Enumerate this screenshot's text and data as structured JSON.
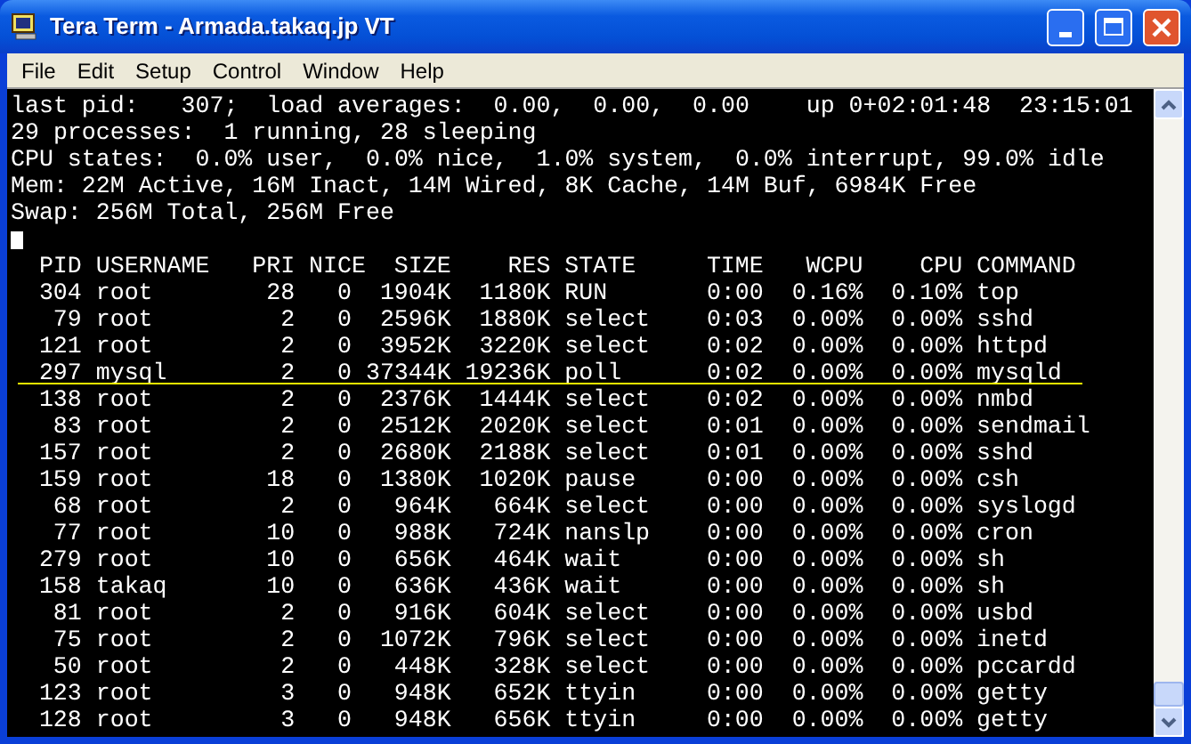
{
  "window": {
    "title": "Tera Term - Armada.takaq.jp VT"
  },
  "menu": [
    "File",
    "Edit",
    "Setup",
    "Control",
    "Window",
    "Help"
  ],
  "terminal": {
    "lines": [
      "last pid:   307;  load averages:  0.00,  0.00,  0.00    up 0+02:01:48  23:15:01",
      "29 processes:  1 running, 28 sleeping",
      "CPU states:  0.0% user,  0.0% nice,  1.0% system,  0.0% interrupt, 99.0% idle",
      "Mem: 22M Active, 16M Inact, 14M Wired, 8K Cache, 14M Buf, 6984K Free",
      "Swap: 256M Total, 256M Free"
    ],
    "cursor": true,
    "table": {
      "columns": [
        "PID",
        "USERNAME",
        "PRI",
        "NICE",
        "SIZE",
        "RES",
        "STATE",
        "TIME",
        "WCPU",
        "CPU",
        "COMMAND"
      ],
      "rows": [
        {
          "cells": [
            "304",
            "root",
            "28",
            "0",
            "1904K",
            "1180K",
            "RUN",
            "0:00",
            "0.16%",
            "0.10%",
            "top"
          ],
          "underlined": false
        },
        {
          "cells": [
            "79",
            "root",
            "2",
            "0",
            "2596K",
            "1880K",
            "select",
            "0:03",
            "0.00%",
            "0.00%",
            "sshd"
          ],
          "underlined": false
        },
        {
          "cells": [
            "121",
            "root",
            "2",
            "0",
            "3952K",
            "3220K",
            "select",
            "0:02",
            "0.00%",
            "0.00%",
            "httpd"
          ],
          "underlined": false
        },
        {
          "cells": [
            "297",
            "mysql",
            "2",
            "0",
            "37344K",
            "19236K",
            "poll",
            "0:02",
            "0.00%",
            "0.00%",
            "mysqld"
          ],
          "underlined": true
        },
        {
          "cells": [
            "138",
            "root",
            "2",
            "0",
            "2376K",
            "1444K",
            "select",
            "0:02",
            "0.00%",
            "0.00%",
            "nmbd"
          ],
          "underlined": false
        },
        {
          "cells": [
            "83",
            "root",
            "2",
            "0",
            "2512K",
            "2020K",
            "select",
            "0:01",
            "0.00%",
            "0.00%",
            "sendmail"
          ],
          "underlined": false
        },
        {
          "cells": [
            "157",
            "root",
            "2",
            "0",
            "2680K",
            "2188K",
            "select",
            "0:01",
            "0.00%",
            "0.00%",
            "sshd"
          ],
          "underlined": false
        },
        {
          "cells": [
            "159",
            "root",
            "18",
            "0",
            "1380K",
            "1020K",
            "pause",
            "0:00",
            "0.00%",
            "0.00%",
            "csh"
          ],
          "underlined": false
        },
        {
          "cells": [
            "68",
            "root",
            "2",
            "0",
            "964K",
            "664K",
            "select",
            "0:00",
            "0.00%",
            "0.00%",
            "syslogd"
          ],
          "underlined": false
        },
        {
          "cells": [
            "77",
            "root",
            "10",
            "0",
            "988K",
            "724K",
            "nanslp",
            "0:00",
            "0.00%",
            "0.00%",
            "cron"
          ],
          "underlined": false
        },
        {
          "cells": [
            "279",
            "root",
            "10",
            "0",
            "656K",
            "464K",
            "wait",
            "0:00",
            "0.00%",
            "0.00%",
            "sh"
          ],
          "underlined": false
        },
        {
          "cells": [
            "158",
            "takaq",
            "10",
            "0",
            "636K",
            "436K",
            "wait",
            "0:00",
            "0.00%",
            "0.00%",
            "sh"
          ],
          "underlined": false
        },
        {
          "cells": [
            "81",
            "root",
            "2",
            "0",
            "916K",
            "604K",
            "select",
            "0:00",
            "0.00%",
            "0.00%",
            "usbd"
          ],
          "underlined": false
        },
        {
          "cells": [
            "75",
            "root",
            "2",
            "0",
            "1072K",
            "796K",
            "select",
            "0:00",
            "0.00%",
            "0.00%",
            "inetd"
          ],
          "underlined": false
        },
        {
          "cells": [
            "50",
            "root",
            "2",
            "0",
            "448K",
            "328K",
            "select",
            "0:00",
            "0.00%",
            "0.00%",
            "pccardd"
          ],
          "underlined": false
        },
        {
          "cells": [
            "123",
            "root",
            "3",
            "0",
            "948K",
            "652K",
            "ttyin",
            "0:00",
            "0.00%",
            "0.00%",
            "getty"
          ],
          "underlined": false
        },
        {
          "cells": [
            "128",
            "root",
            "3",
            "0",
            "948K",
            "656K",
            "ttyin",
            "0:00",
            "0.00%",
            "0.00%",
            "getty"
          ],
          "underlined": false
        }
      ]
    }
  }
}
